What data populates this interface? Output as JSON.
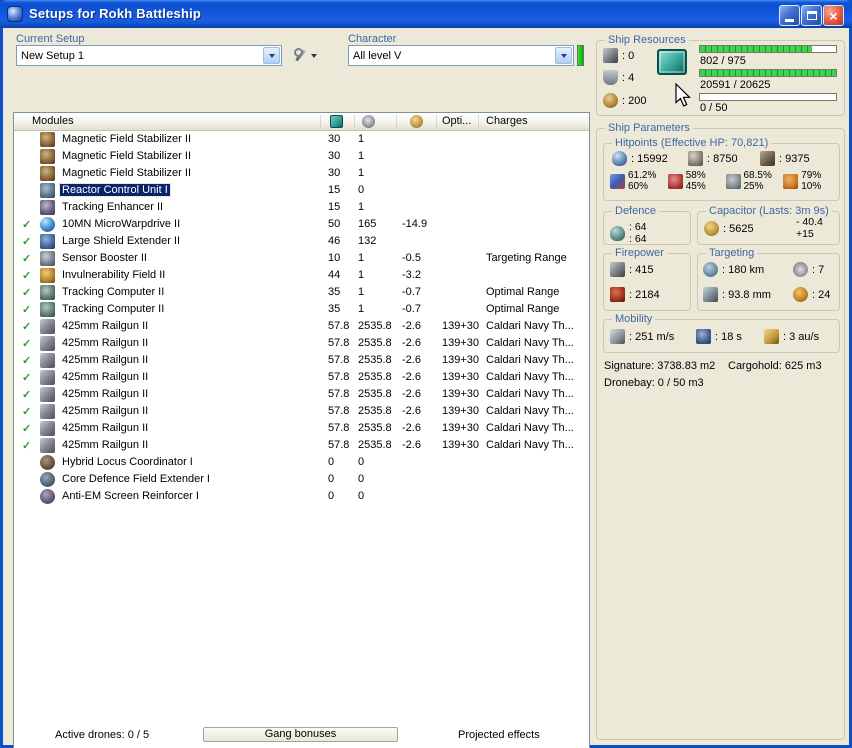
{
  "window": {
    "title": "Setups for Rokh Battleship"
  },
  "toolbar": {
    "current_setup_label": "Current Setup",
    "current_setup_value": "New Setup 1",
    "character_label": "Character",
    "character_value": "All level V"
  },
  "modules_table": {
    "header": {
      "modules": "Modules",
      "opti": "Opti...",
      "charges": "Charges"
    },
    "rows": [
      {
        "check": false,
        "icon": "magstab",
        "name": "Magnetic Field Stabilizer II",
        "cpu": "30",
        "pg": "1",
        "cap": "",
        "opti": "",
        "charges": "",
        "selected": false
      },
      {
        "check": false,
        "icon": "magstab",
        "name": "Magnetic Field Stabilizer II",
        "cpu": "30",
        "pg": "1",
        "cap": "",
        "opti": "",
        "charges": "",
        "selected": false
      },
      {
        "check": false,
        "icon": "magstab",
        "name": "Magnetic Field Stabilizer II",
        "cpu": "30",
        "pg": "1",
        "cap": "",
        "opti": "",
        "charges": "",
        "selected": false
      },
      {
        "check": false,
        "icon": "reactor",
        "name": "Reactor Control Unit I",
        "cpu": "15",
        "pg": "0",
        "cap": "",
        "opti": "",
        "charges": "",
        "selected": true
      },
      {
        "check": false,
        "icon": "tracken",
        "name": "Tracking Enhancer II",
        "cpu": "15",
        "pg": "1",
        "cap": "",
        "opti": "",
        "charges": "",
        "selected": false
      },
      {
        "check": true,
        "icon": "mwd",
        "name": "10MN MicroWarpdrive II",
        "cpu": "50",
        "pg": "165",
        "cap": "-14.9",
        "opti": "",
        "charges": "",
        "selected": false
      },
      {
        "check": true,
        "icon": "lse",
        "name": "Large Shield Extender II",
        "cpu": "46",
        "pg": "132",
        "cap": "",
        "opti": "",
        "charges": "",
        "selected": false
      },
      {
        "check": true,
        "icon": "sensorb",
        "name": "Sensor Booster II",
        "cpu": "10",
        "pg": "1",
        "cap": "-0.5",
        "opti": "",
        "charges": "Targeting Range",
        "selected": false
      },
      {
        "check": true,
        "icon": "invuln",
        "name": "Invulnerability Field II",
        "cpu": "44",
        "pg": "1",
        "cap": "-3.2",
        "opti": "",
        "charges": "",
        "selected": false
      },
      {
        "check": true,
        "icon": "trackc",
        "name": "Tracking Computer II",
        "cpu": "35",
        "pg": "1",
        "cap": "-0.7",
        "opti": "",
        "charges": "Optimal Range",
        "selected": false
      },
      {
        "check": true,
        "icon": "trackc",
        "name": "Tracking Computer II",
        "cpu": "35",
        "pg": "1",
        "cap": "-0.7",
        "opti": "",
        "charges": "Optimal Range",
        "selected": false
      },
      {
        "check": true,
        "icon": "railgun",
        "name": "425mm Railgun II",
        "cpu": "57.8",
        "pg": "2535.8",
        "cap": "-2.6",
        "opti": "139+30",
        "charges": "Caldari Navy Th...",
        "selected": false
      },
      {
        "check": true,
        "icon": "railgun",
        "name": "425mm Railgun II",
        "cpu": "57.8",
        "pg": "2535.8",
        "cap": "-2.6",
        "opti": "139+30",
        "charges": "Caldari Navy Th...",
        "selected": false
      },
      {
        "check": true,
        "icon": "railgun",
        "name": "425mm Railgun II",
        "cpu": "57.8",
        "pg": "2535.8",
        "cap": "-2.6",
        "opti": "139+30",
        "charges": "Caldari Navy Th...",
        "selected": false
      },
      {
        "check": true,
        "icon": "railgun",
        "name": "425mm Railgun II",
        "cpu": "57.8",
        "pg": "2535.8",
        "cap": "-2.6",
        "opti": "139+30",
        "charges": "Caldari Navy Th...",
        "selected": false
      },
      {
        "check": true,
        "icon": "railgun",
        "name": "425mm Railgun II",
        "cpu": "57.8",
        "pg": "2535.8",
        "cap": "-2.6",
        "opti": "139+30",
        "charges": "Caldari Navy Th...",
        "selected": false
      },
      {
        "check": true,
        "icon": "railgun",
        "name": "425mm Railgun II",
        "cpu": "57.8",
        "pg": "2535.8",
        "cap": "-2.6",
        "opti": "139+30",
        "charges": "Caldari Navy Th...",
        "selected": false
      },
      {
        "check": true,
        "icon": "railgun",
        "name": "425mm Railgun II",
        "cpu": "57.8",
        "pg": "2535.8",
        "cap": "-2.6",
        "opti": "139+30",
        "charges": "Caldari Navy Th...",
        "selected": false
      },
      {
        "check": true,
        "icon": "railgun",
        "name": "425mm Railgun II",
        "cpu": "57.8",
        "pg": "2535.8",
        "cap": "-2.6",
        "opti": "139+30",
        "charges": "Caldari Navy Th...",
        "selected": false
      },
      {
        "check": false,
        "icon": "rig-hybrid",
        "name": "Hybrid Locus Coordinator I",
        "cpu": "0",
        "pg": "0",
        "cap": "",
        "opti": "",
        "charges": "",
        "selected": false
      },
      {
        "check": false,
        "icon": "rig-shield",
        "name": "Core Defence Field Extender I",
        "cpu": "0",
        "pg": "0",
        "cap": "",
        "opti": "",
        "charges": "",
        "selected": false
      },
      {
        "check": false,
        "icon": "rig-em",
        "name": "Anti-EM Screen Reinforcer I",
        "cpu": "0",
        "pg": "0",
        "cap": "",
        "opti": "",
        "charges": "",
        "selected": false
      }
    ]
  },
  "bottom_bar": {
    "active_drones": "Active drones: 0 / 5",
    "gang_bonuses": "Gang bonuses",
    "projected_effects": "Projected effects"
  },
  "ship_resources": {
    "title": "Ship Resources",
    "turret_hardpoints": ": 0",
    "launcher_hardpoints": ": 4",
    "calibration": ": 200",
    "bars": [
      {
        "label": "802 / 975",
        "pct": 82.3
      },
      {
        "label": "20591 / 20625",
        "pct": 99.8
      },
      {
        "label": "0 / 50",
        "pct": 0
      }
    ]
  },
  "ship_parameters": {
    "title": "Ship Parameters",
    "hitpoints": {
      "title": "Hitpoints (Effective HP: 70,821)",
      "shield": ": 15992",
      "armor": ": 8750",
      "structure": ": 9375",
      "resists": [
        {
          "top": "61.2%",
          "bottom": "60%"
        },
        {
          "top": "58%",
          "bottom": "45%"
        },
        {
          "top": "68.5%",
          "bottom": "25%"
        },
        {
          "top": "79%",
          "bottom": "10%"
        }
      ]
    },
    "defence": {
      "title": "Defence",
      "value_top": ": 64",
      "value_bottom": ": 64"
    },
    "capacitor": {
      "title": "Capacitor (Lasts: 3m 9s)",
      "amount": ": 5625",
      "delta_minus": "- 40.4",
      "delta_plus": "+15"
    },
    "firepower": {
      "title": "Firepower",
      "volley": ": 415",
      "dps": ": 2184"
    },
    "targeting": {
      "title": "Targeting",
      "range": ": 180 km",
      "max_targets": ": 7",
      "scan_resolution": ": 93.8 mm",
      "sensor_strength": ": 24"
    },
    "mobility": {
      "title": "Mobility",
      "speed": ": 251 m/s",
      "agility": ": 18 s",
      "warp_speed": ": 3 au/s"
    },
    "signature": "Signature: 3738.83 m2",
    "cargohold": "Cargohold: 625 m3",
    "dronebay": "Dronebay: 0 / 50 m3"
  },
  "colors": {
    "titlebar_blue": "#1257da",
    "selection_navy": "#0a246a",
    "label_blue": "#4065a5",
    "active_check_green": "#2ca02c",
    "resource_bar_green": "#3fd24f",
    "character_indicator_green": "#27cc27"
  }
}
